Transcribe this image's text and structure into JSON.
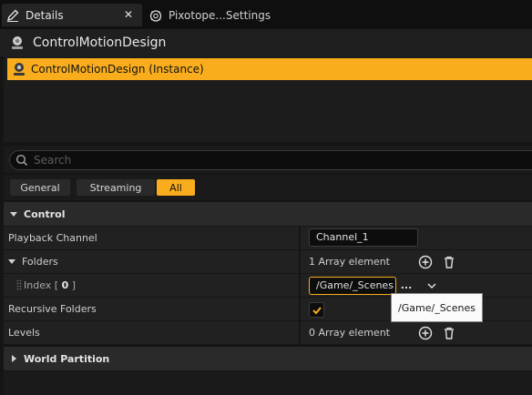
{
  "tabs": [
    {
      "label": "Details",
      "icon": "pencil-icon",
      "active": true,
      "close_glyph": "✕"
    },
    {
      "label": "Pixotope...Settings",
      "icon": "pixotope-icon",
      "active": false
    }
  ],
  "actor": {
    "title": "ControlMotionDesign",
    "icon": "component-icon"
  },
  "components": {
    "selected_label": "ControlMotionDesign (Instance)"
  },
  "search": {
    "placeholder": "Search",
    "value": ""
  },
  "filters": [
    {
      "label": "General",
      "active": false
    },
    {
      "label": "Streaming",
      "active": false
    },
    {
      "label": "All",
      "active": true
    }
  ],
  "control_category": {
    "label": "Control",
    "expanded": true,
    "properties": {
      "playback_channel": {
        "name": "Playback Channel",
        "value": "Channel_1"
      },
      "folders": {
        "name": "Folders",
        "summary": "1 Array element",
        "expanded": true,
        "index_label": "Index [ ",
        "index_value": "0",
        "index_suffix": " ]",
        "element_value": "/Game/_Scenes",
        "browse_glyph": "..."
      },
      "recursive_folders": {
        "name": "Recursive Folders",
        "checked": true
      },
      "levels": {
        "name": "Levels",
        "summary": "0 Array element"
      }
    }
  },
  "world_partition_category": {
    "label": "World Partition",
    "expanded": false
  },
  "tooltip": {
    "text": "/Game/_Scenes"
  },
  "colors": {
    "accent": "#f9ad1c",
    "background": "#151515",
    "row": "#212121",
    "category": "#2a2a2a"
  }
}
